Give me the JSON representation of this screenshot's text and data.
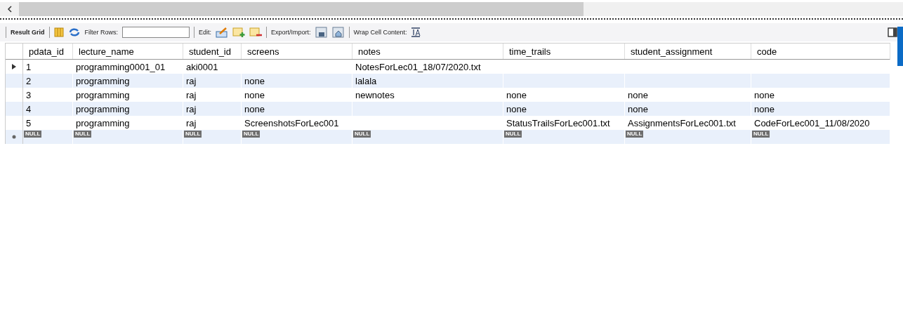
{
  "toolbar": {
    "result_grid_label": "Result Grid",
    "filter_label": "Filter Rows:",
    "edit_label": "Edit:",
    "export_label": "Export/Import:",
    "wrap_label": "Wrap Cell Content:"
  },
  "table": {
    "columns": [
      "pdata_id",
      "lecture_name",
      "student_id",
      "screens",
      "notes",
      "time_trails",
      "student_assignment",
      "code"
    ],
    "rows": [
      {
        "current": true,
        "cells": [
          "1",
          "programming0001_01",
          "aki0001",
          null,
          "NotesForLec01_18/07/2020.txt",
          null,
          null,
          null
        ]
      },
      {
        "current": false,
        "cells": [
          "2",
          "programming",
          "raj",
          "none",
          "lalala",
          null,
          null,
          null
        ]
      },
      {
        "current": false,
        "cells": [
          "3",
          "programming",
          "raj",
          "none",
          "newnotes",
          "none",
          "none",
          "none"
        ]
      },
      {
        "current": false,
        "cells": [
          "4",
          "programming",
          "raj",
          "none",
          null,
          "none",
          "none",
          "none"
        ]
      },
      {
        "current": false,
        "cells": [
          "5",
          "programming",
          "raj",
          "ScreenshotsForLec001",
          null,
          "StatusTrailsForLec001.txt",
          "AssignmentsForLec001.txt",
          "CodeForLec001_11/08/2020"
        ]
      }
    ],
    "new_row": [
      "NULL",
      "NULL",
      "NULL",
      "NULL",
      "NULL",
      "NULL",
      "NULL",
      "NULL"
    ]
  }
}
